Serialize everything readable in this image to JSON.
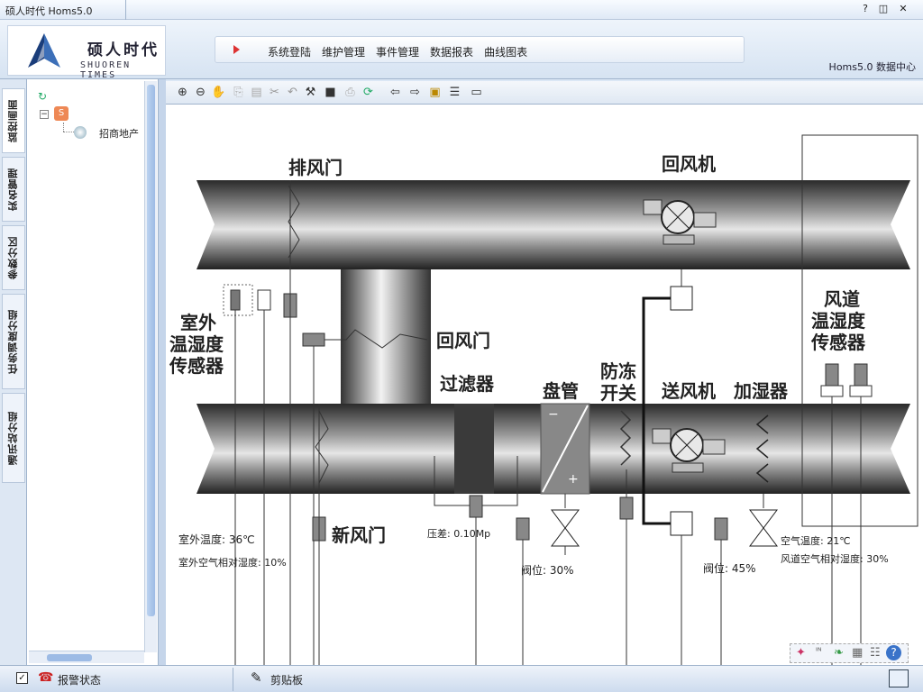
{
  "window": {
    "title": "硕人时代  Homs5.0",
    "controls": [
      "?",
      "◫",
      "✕"
    ]
  },
  "logo": {
    "brand": "硕人时代",
    "english": "SHUOREN TIMES"
  },
  "menu": {
    "items": [
      "系统登陆",
      "维护管理",
      "事件管理",
      "数据报表",
      "曲线图表"
    ]
  },
  "header": {
    "datacenter": "Homs5.0 数据中心"
  },
  "side_tabs": [
    "监控画面",
    "实名管理",
    "参数分区",
    "任务调度分组",
    "通讯站分组"
  ],
  "tree": {
    "root": "",
    "child": "招商地产"
  },
  "toolbar": {
    "icons": [
      "zoom-in-icon",
      "zoom-out-icon",
      "pan-hand-icon",
      "copy-icon",
      "paste-icon",
      "cut-icon",
      "undo-icon",
      "tools-icon",
      "stop-icon",
      "print-icon",
      "refresh-icon",
      "arrow-left-icon",
      "arrow-right-icon",
      "folder-up-icon",
      "layers-icon",
      "fullscreen-icon"
    ]
  },
  "diagram": {
    "labels": {
      "exhaust_damper": "排风门",
      "return_fan": "回风机",
      "outdoor_sensor": [
        "室外",
        "温湿度",
        "传感器"
      ],
      "return_damper": "回风门",
      "filter": "过滤器",
      "coil": "盘管",
      "antifreeze": [
        "防冻",
        "开关"
      ],
      "supply_fan": "送风机",
      "humidifier": "加湿器",
      "duct_sensor": [
        "风道",
        "温湿度",
        "传感器"
      ],
      "fresh_damper": "新风门"
    },
    "readouts": {
      "outdoor_temp": "室外温度: 36℃",
      "outdoor_rh": "室外空气相对湿度: 10%",
      "pressure_diff": "压差: 0.10Mp",
      "coil_valve": "阀位: 30%",
      "humid_valve": "阀位: 45%",
      "air_temp": "空气温度: 21℃",
      "duct_rh": "风道空气相对湿度: 30%"
    }
  },
  "status": {
    "alarm": "报警状态",
    "clipboard": "剪贴板"
  }
}
